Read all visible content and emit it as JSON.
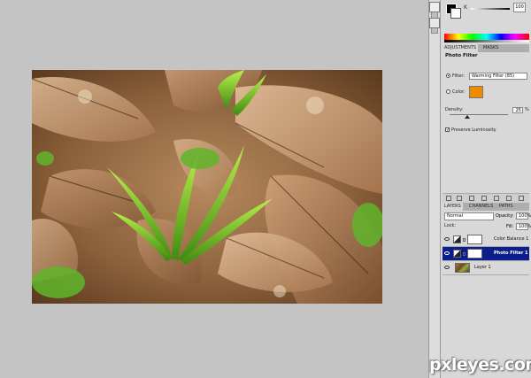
{
  "document": {
    "image_description_icon": "photo-canvas"
  },
  "color_panel": {
    "k_label": "K",
    "k_value": "100"
  },
  "adjustments": {
    "tabs": [
      "ADJUSTMENTS",
      "MASKS"
    ],
    "title": "Photo Filter",
    "filter_label": "Filter:",
    "filter_value": "Warming Filter (85)",
    "color_label": "Color:",
    "filter_color": "#f08a00",
    "density_label": "Density:",
    "density_value": "25",
    "density_unit": "%",
    "density_fraction": 0.25,
    "preserve_luminosity_label": "Preserve Luminosity",
    "preserve_luminosity_checked": true
  },
  "layers": {
    "tabs": [
      "LAYERS",
      "CHANNELS",
      "PATHS"
    ],
    "blend_mode": "Normal",
    "opacity_label": "Opacity:",
    "opacity_value": "100%",
    "lock_label": "Lock:",
    "fill_label": "Fill:",
    "fill_value": "100%",
    "items": [
      {
        "name": "Color Balance 1",
        "type": "adjustment",
        "selected": false
      },
      {
        "name": "Photo Filter 1",
        "type": "adjustment",
        "selected": true
      },
      {
        "name": "Layer 1",
        "type": "image",
        "selected": false
      }
    ]
  },
  "watermark": "pxleyes.com"
}
